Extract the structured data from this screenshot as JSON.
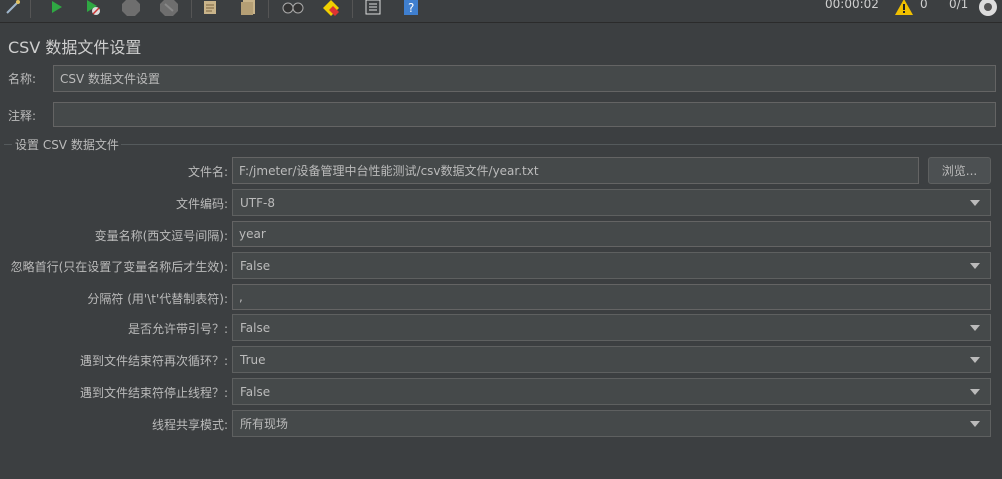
{
  "toolbar": {
    "timer": "00:00:02",
    "warning_count": "0",
    "thread_ratio": "0/1"
  },
  "panel": {
    "title": "CSV 数据文件设置",
    "name_label": "名称:",
    "name_value": "CSV 数据文件设置",
    "comment_label": "注释:",
    "comment_value": ""
  },
  "group": {
    "title": "设置 CSV 数据文件",
    "filename_label": "文件名:",
    "filename_value": "F:/jmeter/设备管理中台性能测试/csv数据文件/year.txt",
    "browse_label": "浏览...",
    "encoding_label": "文件编码:",
    "encoding_value": "UTF-8",
    "varnames_label": "变量名称(西文逗号间隔):",
    "varnames_value": "year",
    "ignore_first_label": "忽略首行(只在设置了变量名称后才生效):",
    "ignore_first_value": "False",
    "delimiter_label": "分隔符 (用'\\t'代替制表符):",
    "delimiter_value": ",",
    "quoted_label": "是否允许带引号？:",
    "quoted_value": "False",
    "recycle_label": "遇到文件结束符再次循环？:",
    "recycle_value": "True",
    "stop_label": "遇到文件结束符停止线程？:",
    "stop_value": "False",
    "share_label": "线程共享模式:",
    "share_value": "所有现场"
  }
}
